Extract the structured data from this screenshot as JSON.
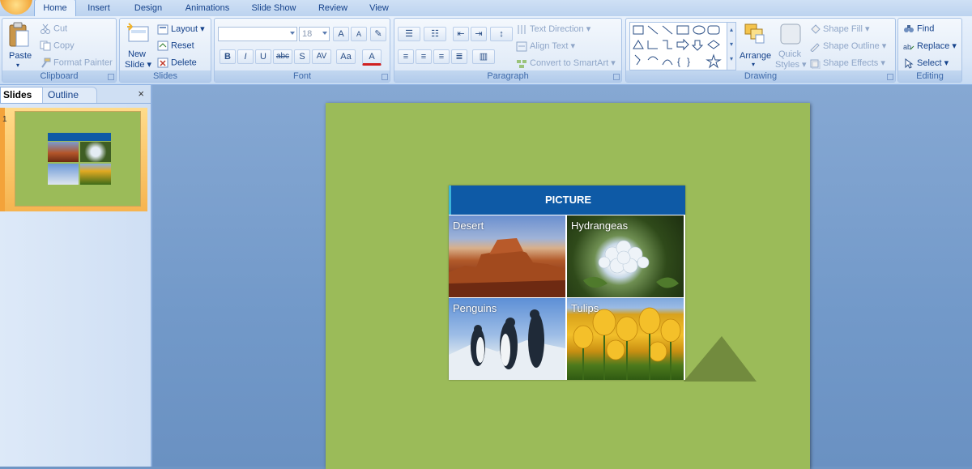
{
  "tabs": [
    {
      "label": "Home",
      "active": true
    },
    {
      "label": "Insert"
    },
    {
      "label": "Design"
    },
    {
      "label": "Animations"
    },
    {
      "label": "Slide Show"
    },
    {
      "label": "Review"
    },
    {
      "label": "View"
    }
  ],
  "clipboard": {
    "paste": "Paste",
    "cut": "Cut",
    "copy": "Copy",
    "format_painter": "Format Painter",
    "label": "Clipboard"
  },
  "slides_group": {
    "new_slide_line1": "New",
    "new_slide_line2": "Slide",
    "layout": "Layout",
    "reset": "Reset",
    "delete": "Delete",
    "label": "Slides"
  },
  "font_group": {
    "font_size": "18",
    "label": "Font",
    "grow": "A",
    "shrink": "A",
    "bold": "B",
    "italic": "I",
    "underline": "U",
    "strike": "abc",
    "shadow": "S",
    "spacing": "AV",
    "case": "Aa",
    "color": "A"
  },
  "paragraph_group": {
    "text_direction": "Text Direction",
    "align_text": "Align Text",
    "convert_smartart": "Convert to SmartArt",
    "label": "Paragraph"
  },
  "drawing_group": {
    "arrange": "Arrange",
    "quick_styles_line1": "Quick",
    "quick_styles_line2": "Styles",
    "shape_fill": "Shape Fill",
    "shape_outline": "Shape Outline",
    "shape_effects": "Shape Effects",
    "label": "Drawing"
  },
  "editing_group": {
    "find": "Find",
    "replace": "Replace",
    "select": "Select",
    "label": "Editing"
  },
  "pane": {
    "slides_tab": "Slides",
    "outline_tab": "Outline",
    "close": "×",
    "slide_number": "1"
  },
  "slide": {
    "table_header": "PICTURE",
    "cells": [
      "Desert",
      "Hydrangeas",
      "Penguins",
      "Tulips"
    ]
  },
  "colors": {
    "slide_bg": "#9bbb59",
    "header_blue": "#0e5aa6"
  }
}
